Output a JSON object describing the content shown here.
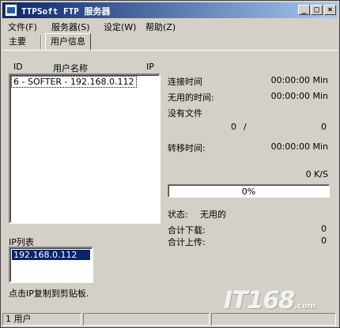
{
  "window": {
    "title": "TTPSoft FTP 服务器",
    "minimize_glyph": "_",
    "maximize_glyph": "□",
    "close_glyph": "×"
  },
  "menu": {
    "items": [
      "文件(F)",
      "服务器(S)",
      "设定(W)",
      "帮助(Z)"
    ]
  },
  "tabs": {
    "items": [
      "主要",
      "用户信息"
    ],
    "active": "用户信息"
  },
  "users_table": {
    "headers": [
      "ID",
      "用户名称",
      "IP"
    ],
    "rows": [
      "6 - SOFTER - 192.168.0.112"
    ]
  },
  "ip_list": {
    "label": "IP列表",
    "items": [
      "192.168.0.112"
    ],
    "hint": "点击IP复制到剪贴板."
  },
  "info": {
    "connect_time_label": "连接时间",
    "connect_time_value": "00:00:00 Min",
    "idle_time_label": "无用的时间:",
    "idle_time_value": "00:00:00 Min",
    "no_file_label": "没有文件",
    "file_count_left": "0",
    "file_count_sep": "/",
    "file_count_right": "0",
    "transfer_time_label": "转移时间:",
    "transfer_time_value": "00:00:00 Min",
    "speed": "0 K/S",
    "progress_text": "0%",
    "progress_fraction": 0,
    "status_label": "状态:",
    "status_value": "无用的",
    "download_total_label": "合计下载:",
    "download_total_value": "0",
    "upload_total_label": "合计上传:",
    "upload_total_value": "0"
  },
  "statusbar": {
    "panel1": "1 用户",
    "panel2": "",
    "panel3": ""
  },
  "watermark": {
    "text": "IT168",
    "suffix": ".com"
  }
}
